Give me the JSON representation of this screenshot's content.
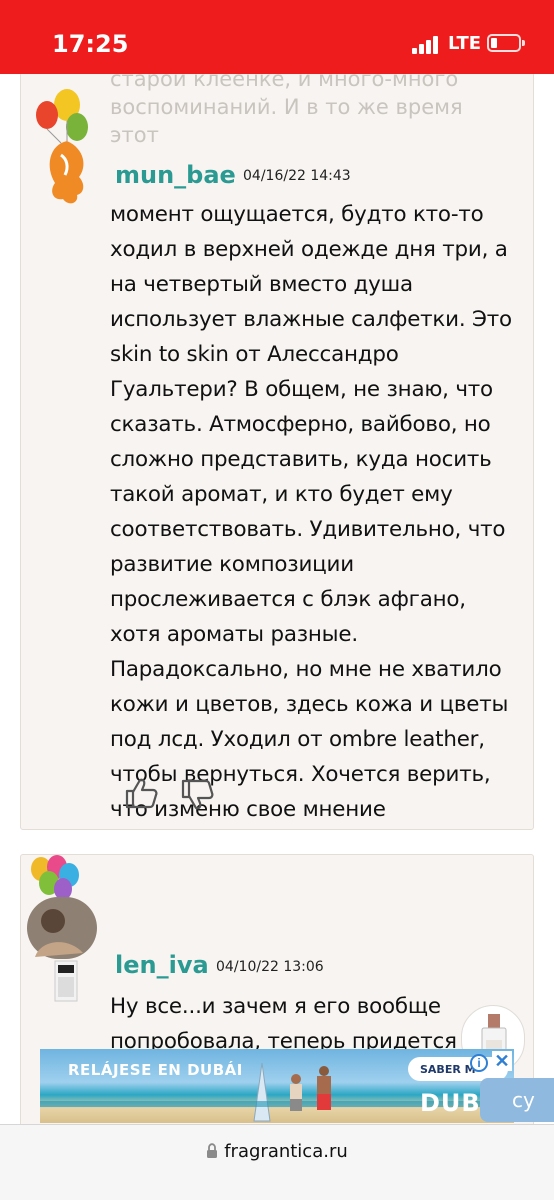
{
  "status_bar": {
    "time": "17:25",
    "network": "LTE",
    "battery_level": 0.15,
    "background_color": "#ee1c1c"
  },
  "reviews": [
    {
      "username": "mun_bae",
      "date": "04/16/22 14:43",
      "faded_text": "старой клеенке, и много-много воспоминаний. И в то же время этот",
      "text": "момент ощущается, будто кто-то ходил в верхней одежде дня три, а на четвертый вместо душа использует влажные салфетки. Это skin to skin от Алессандро Гуальтери? В общем, не знаю, что сказать. Атмосферно, вайбово, но сложно представить, куда носить такой аромат, и кто будет ему соответствовать. Удивительно, что развитие композиции прослеживается с блэк афгано, хотя ароматы разные. Парадоксально, но мне не хватило кожи и цветов, здесь кожа и цветы под лсд. Уходил от ombre leather, чтобы вернуться. Хочется верить, что изменю свое мнение",
      "avatar_icon": "balloon-face-avatar",
      "like_icon": "thumbs-up-icon",
      "dislike_icon": "thumbs-down-icon"
    },
    {
      "username": "len_iva",
      "date": "04/10/22 13:06",
      "text": "Ну все...и зачем я его вообще попробовала, теперь придется выделять на него мешочек с золотом..и ведь объективно",
      "avatar_icon": "balloons-photo-avatar",
      "perfume_icon": "perfume-bottle-icon"
    }
  ],
  "ad": {
    "headline": "RELÁJESE EN DUBÁI",
    "cta": "SABER M",
    "brand": "DUBAI",
    "info_icon": "info-icon",
    "close_icon": "close-icon"
  },
  "side_tab": {
    "text": "cy"
  },
  "url_bar": {
    "domain": "fragrantica.ru",
    "lock_icon": "lock-icon"
  },
  "colors": {
    "username": "#2a9a92",
    "card_background": "#f7f4f1",
    "status_bar": "#ee1c1c"
  }
}
